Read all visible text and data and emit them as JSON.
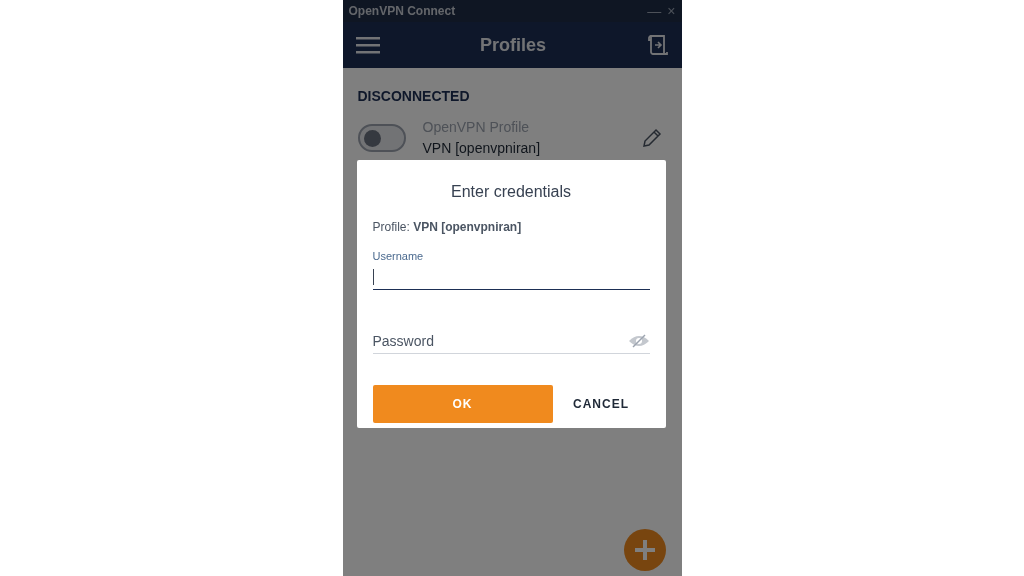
{
  "window": {
    "title": "OpenVPN Connect",
    "controls": [
      "—",
      "×"
    ]
  },
  "header": {
    "title": "Profiles"
  },
  "status": "DISCONNECTED",
  "profile": {
    "name": "OpenVPN Profile",
    "subtitle": "VPN [openvpniran]",
    "on": false
  },
  "dialog": {
    "title": "Enter credentials",
    "profile_line": "Profile: **VPN [openvpniran]**",
    "fields": [
      {
        "kind": "text",
        "label": "Username",
        "focused": true
      },
      {
        "kind": "password",
        "placeholder": "Password"
      }
    ],
    "buttons": [
      {
        "kind": "primary",
        "label": "OK"
      },
      {
        "kind": "flat",
        "label": "CANCEL"
      }
    ]
  }
}
